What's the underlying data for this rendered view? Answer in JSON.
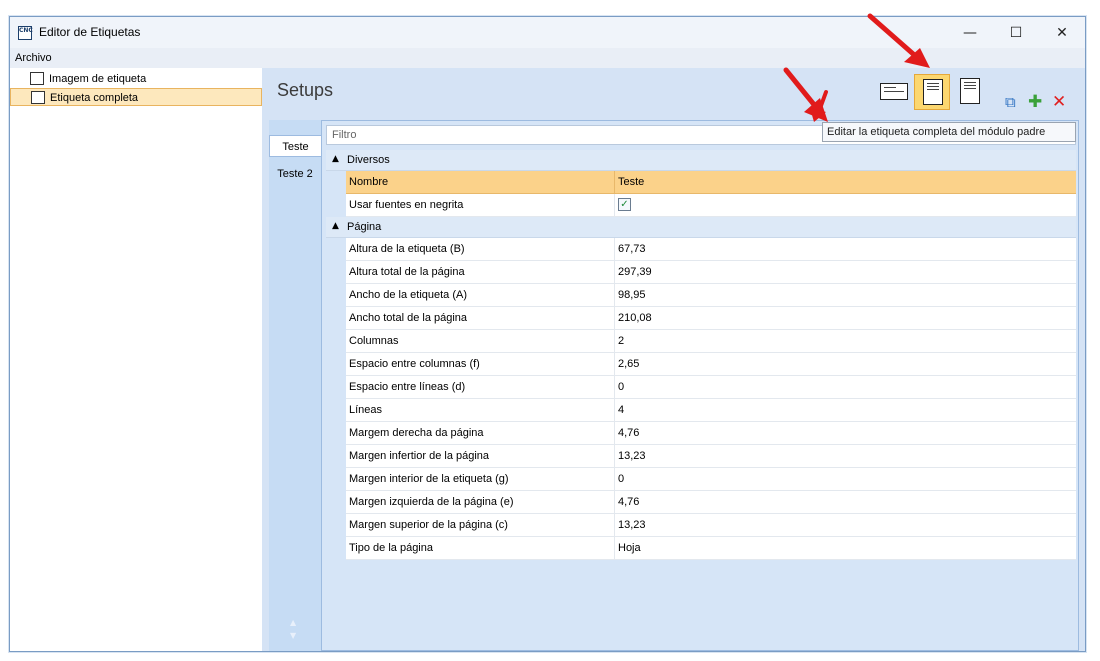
{
  "window": {
    "title": "Editor de Etiquetas",
    "app_icon_text": "CNC",
    "controls": {
      "minimize": "—",
      "maximize": "☐",
      "close": "✕"
    }
  },
  "menu": {
    "archivo": "Archivo"
  },
  "tree": {
    "items": [
      {
        "label": "Imagem de etiqueta",
        "selected": false
      },
      {
        "label": "Etiqueta completa",
        "selected": true
      }
    ]
  },
  "header": {
    "title": "Setups"
  },
  "toolbar": {
    "tooltip": "Editar la etiqueta completa del módulo padre",
    "buttons": [
      {
        "icon": "label-image-icon",
        "active": false
      },
      {
        "icon": "full-label-icon",
        "active": true
      },
      {
        "icon": "module-icon",
        "active": false
      },
      {
        "icon": "copy-icon"
      },
      {
        "icon": "add-icon",
        "color": "#3aa13a"
      },
      {
        "icon": "delete-icon",
        "color": "#e02020"
      }
    ]
  },
  "tabs": [
    {
      "label": "Teste",
      "active": true
    },
    {
      "label": "Teste 2",
      "active": false
    }
  ],
  "filter": {
    "placeholder": "Filtro"
  },
  "grid": {
    "columns": {
      "name": "Nombre",
      "value": "Teste"
    },
    "groups": [
      {
        "label": "Diversos",
        "rows": [
          {
            "name": "Usar fuentes en negrita",
            "checked": true
          }
        ]
      },
      {
        "label": "Página",
        "rows": [
          {
            "name": "Altura de la etiqueta (B)",
            "value": "67,73"
          },
          {
            "name": "Altura total de la página",
            "value": "297,39"
          },
          {
            "name": "Ancho de la etiqueta (A)",
            "value": "98,95"
          },
          {
            "name": "Ancho total de la página",
            "value": "210,08"
          },
          {
            "name": "Columnas",
            "value": "2"
          },
          {
            "name": "Espacio entre columnas (f)",
            "value": "2,65"
          },
          {
            "name": "Espacio entre líneas (d)",
            "value": "0"
          },
          {
            "name": "Líneas",
            "value": "4"
          },
          {
            "name": "Margem derecha da página",
            "value": "4,76"
          },
          {
            "name": "Margen infertior de la página",
            "value": "13,23"
          },
          {
            "name": "Margen interior de la etiqueta (g)",
            "value": "0"
          },
          {
            "name": "Margen izquierda de la página (e)",
            "value": "4,76"
          },
          {
            "name": "Margen superior de la página (c)",
            "value": "13,23"
          },
          {
            "name": "Tipo de la página",
            "value": "Hoja"
          }
        ]
      }
    ]
  },
  "colors": {
    "accent": "#fcd770",
    "header_row": "#fbd28a",
    "panel": "#d5e3f5",
    "annotation_arrow": "#e11b1b"
  }
}
